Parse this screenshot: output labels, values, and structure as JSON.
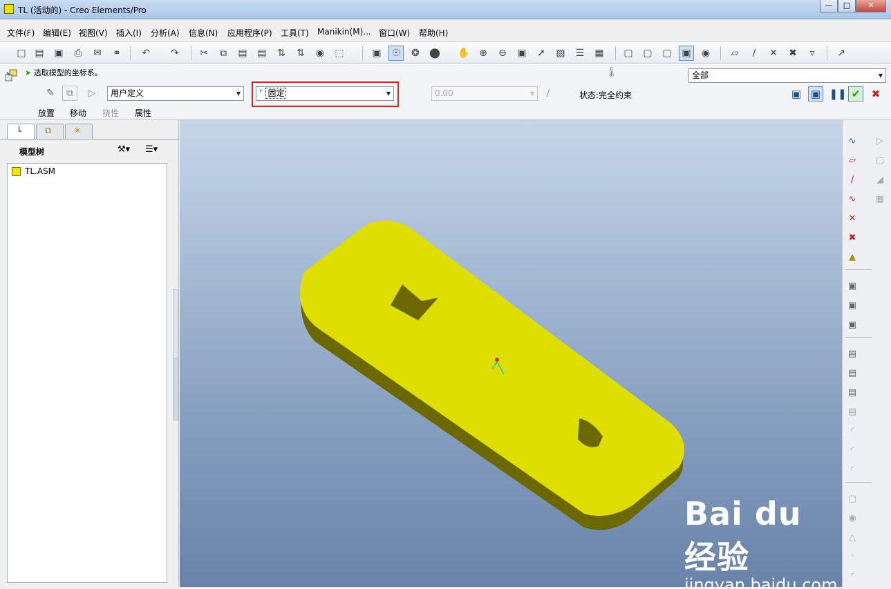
{
  "window": {
    "title": "TL (活动的) - Creo Elements/Pro",
    "buttons": [
      "—",
      "□",
      "✕"
    ]
  },
  "menubar": [
    "文件(F)",
    "编辑(E)",
    "视图(V)",
    "插入(I)",
    "分析(A)",
    "信息(N)",
    "应用程序(P)",
    "工具(T)",
    "Manikin(M)...",
    "窗口(W)",
    "帮助(H)"
  ],
  "dashboard": {
    "prompt": "选取模型的坐标系。",
    "filter_value": "全部",
    "constraint_set": "用户定义",
    "constraint_type": "固定",
    "offset_value": "0.00",
    "status": "状态:完全约束",
    "tabs": [
      "放置",
      "移动",
      "挠性",
      "属性"
    ]
  },
  "panel": {
    "tree_title": "模型树",
    "tree_items": [
      "TL.ASM"
    ]
  },
  "colors": {
    "part_top": "#dede00",
    "part_side": "#6b6800",
    "highlight": "#e5241c"
  },
  "watermark": {
    "brand": "Bai du 经验",
    "url": "jingyan.baidu.com"
  }
}
